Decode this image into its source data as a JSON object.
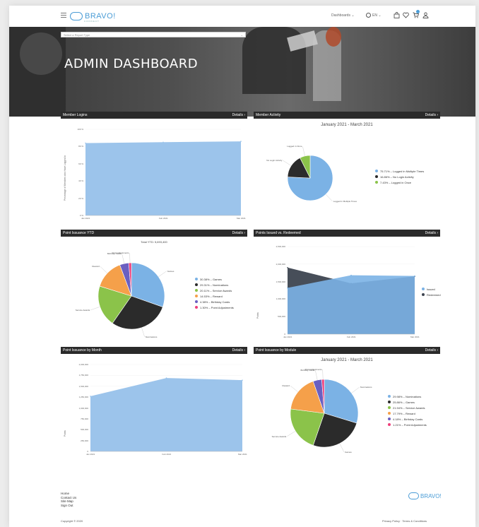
{
  "header": {
    "logo_text": "BRAVO!",
    "logo_sub": "CONNECT",
    "nav_dashboards": "Dashboards ⌄",
    "nav_language": "EN ⌄"
  },
  "hero": {
    "report_select_placeholder": "Select a Report Type",
    "title": "ADMIN DASHBOARD"
  },
  "details_label": "Details ›",
  "panels": {
    "member_logins": {
      "title": "Member Logins",
      "chart_data": {
        "type": "area",
        "x": [
          "Jan 2021",
          "Feb 2021",
          "Mar 2021"
        ],
        "series": [
          {
            "values": [
              84,
              85,
              86
            ]
          }
        ],
        "ylabel": "Percentage of Members who Have Logged In",
        "ylim": [
          0,
          100
        ],
        "yticks": [
          "0 %",
          "20 %",
          "40 %",
          "60 %",
          "80 %",
          "100 %"
        ],
        "color": "#9cc4eb"
      }
    },
    "member_activity": {
      "title": "Member Activity",
      "chart_data": {
        "type": "pie",
        "subtitle": "January 2021 - March 2021",
        "slices": [
          {
            "label": "Logged in Multiple Times",
            "legend": "75.71% – Logged in Multiple Times",
            "value": 75.71,
            "color": "#7bb2e5"
          },
          {
            "label": "No Login Activity",
            "legend": "16.86% – No Login Activity",
            "value": 16.86,
            "color": "#2b2b2b"
          },
          {
            "label": "Logged in Once",
            "legend": "7.43% – Logged in Once",
            "value": 7.43,
            "color": "#8bc34a"
          }
        ]
      }
    },
    "point_issuance_ytd": {
      "title": "Point Issuance YTD",
      "chart_data": {
        "type": "pie",
        "subtitle": "Total YTD: 5,693,400",
        "slices": [
          {
            "label": "Games",
            "legend": "30.38% – Games",
            "value": 30.38,
            "color": "#7bb2e5"
          },
          {
            "label": "Nominations",
            "legend": "29.31% – Nominations",
            "value": 29.31,
            "color": "#2b2b2b"
          },
          {
            "label": "Service Awards",
            "legend": "20.11% – Service Awards",
            "value": 20.11,
            "color": "#8bc34a"
          },
          {
            "label": "Reward",
            "legend": "14.53% – Reward",
            "value": 14.53,
            "color": "#f5a04a"
          },
          {
            "label": "Birthday Cards",
            "legend": "4.38% – Birthday Cards",
            "value": 4.38,
            "color": "#6a5fc1"
          },
          {
            "label": "Point Adjustments",
            "legend": "1.30% – Point Adjustments",
            "value": 1.3,
            "color": "#ef3e7a"
          }
        ]
      }
    },
    "points_issued_vs_redeemed": {
      "title": "Points Issued vs. Redeemed",
      "chart_data": {
        "type": "area",
        "x": [
          "Jan 2021",
          "Feb 2021",
          "Mar 2021"
        ],
        "series": [
          {
            "name": "Issued",
            "values": [
              1320000,
              1680000,
              1660000
            ],
            "color": "#7bb2e5"
          },
          {
            "name": "Redeemed",
            "values": [
              1900000,
              1450000,
              1650000
            ],
            "color": "#3d4450"
          }
        ],
        "ylabel": "Points",
        "ylim": [
          0,
          2500000
        ],
        "yticks": [
          "0",
          "500,000",
          "1,000,000",
          "1,500,000",
          "2,000,000",
          "2,500,000"
        ]
      }
    },
    "point_issuance_by_month": {
      "title": "Point Issuance by Month",
      "chart_data": {
        "type": "area",
        "x": [
          "Jan 2021",
          "Feb 2021",
          "Mar 2021"
        ],
        "series": [
          {
            "values": [
              1270000,
              1690000,
              1640000
            ]
          }
        ],
        "ylabel": "Points",
        "ylim": [
          0,
          2000000
        ],
        "yticks": [
          "0",
          "250,000",
          "500,000",
          "750,000",
          "1,000,000",
          "1,250,000",
          "1,500,000",
          "1,750,000",
          "2,000,000"
        ],
        "color": "#9cc4eb"
      }
    },
    "point_issuance_by_module": {
      "title": "Point Issuance by Module",
      "chart_data": {
        "type": "pie",
        "subtitle": "January 2021 - March 2021",
        "slices": [
          {
            "label": "Nominations",
            "legend": "29.98% – Nominations",
            "value": 29.98,
            "color": "#7bb2e5"
          },
          {
            "label": "Games",
            "legend": "25.86% – Games",
            "value": 25.86,
            "color": "#2b2b2b"
          },
          {
            "label": "Service Awards",
            "legend": "21.94% – Service Awards",
            "value": 21.94,
            "color": "#8bc34a"
          },
          {
            "label": "Reward",
            "legend": "17.79% – Reward",
            "value": 17.79,
            "color": "#f5a04a"
          },
          {
            "label": "Birthday Cards",
            "legend": "4.18% – Birthday Cards",
            "value": 4.18,
            "color": "#6a5fc1"
          },
          {
            "label": "Point Adjustments",
            "legend": "1.21% – Point Adjustments",
            "value": 1.21,
            "color": "#ef3e7a"
          }
        ]
      }
    }
  },
  "footer": {
    "links": [
      "Home",
      "Contact Us",
      "Site Map",
      "Sign Out"
    ],
    "copyright": "Copyright © 2020",
    "legal": "Privacy Policy · Terms & Conditions",
    "logo_text": "BRAVO!"
  }
}
